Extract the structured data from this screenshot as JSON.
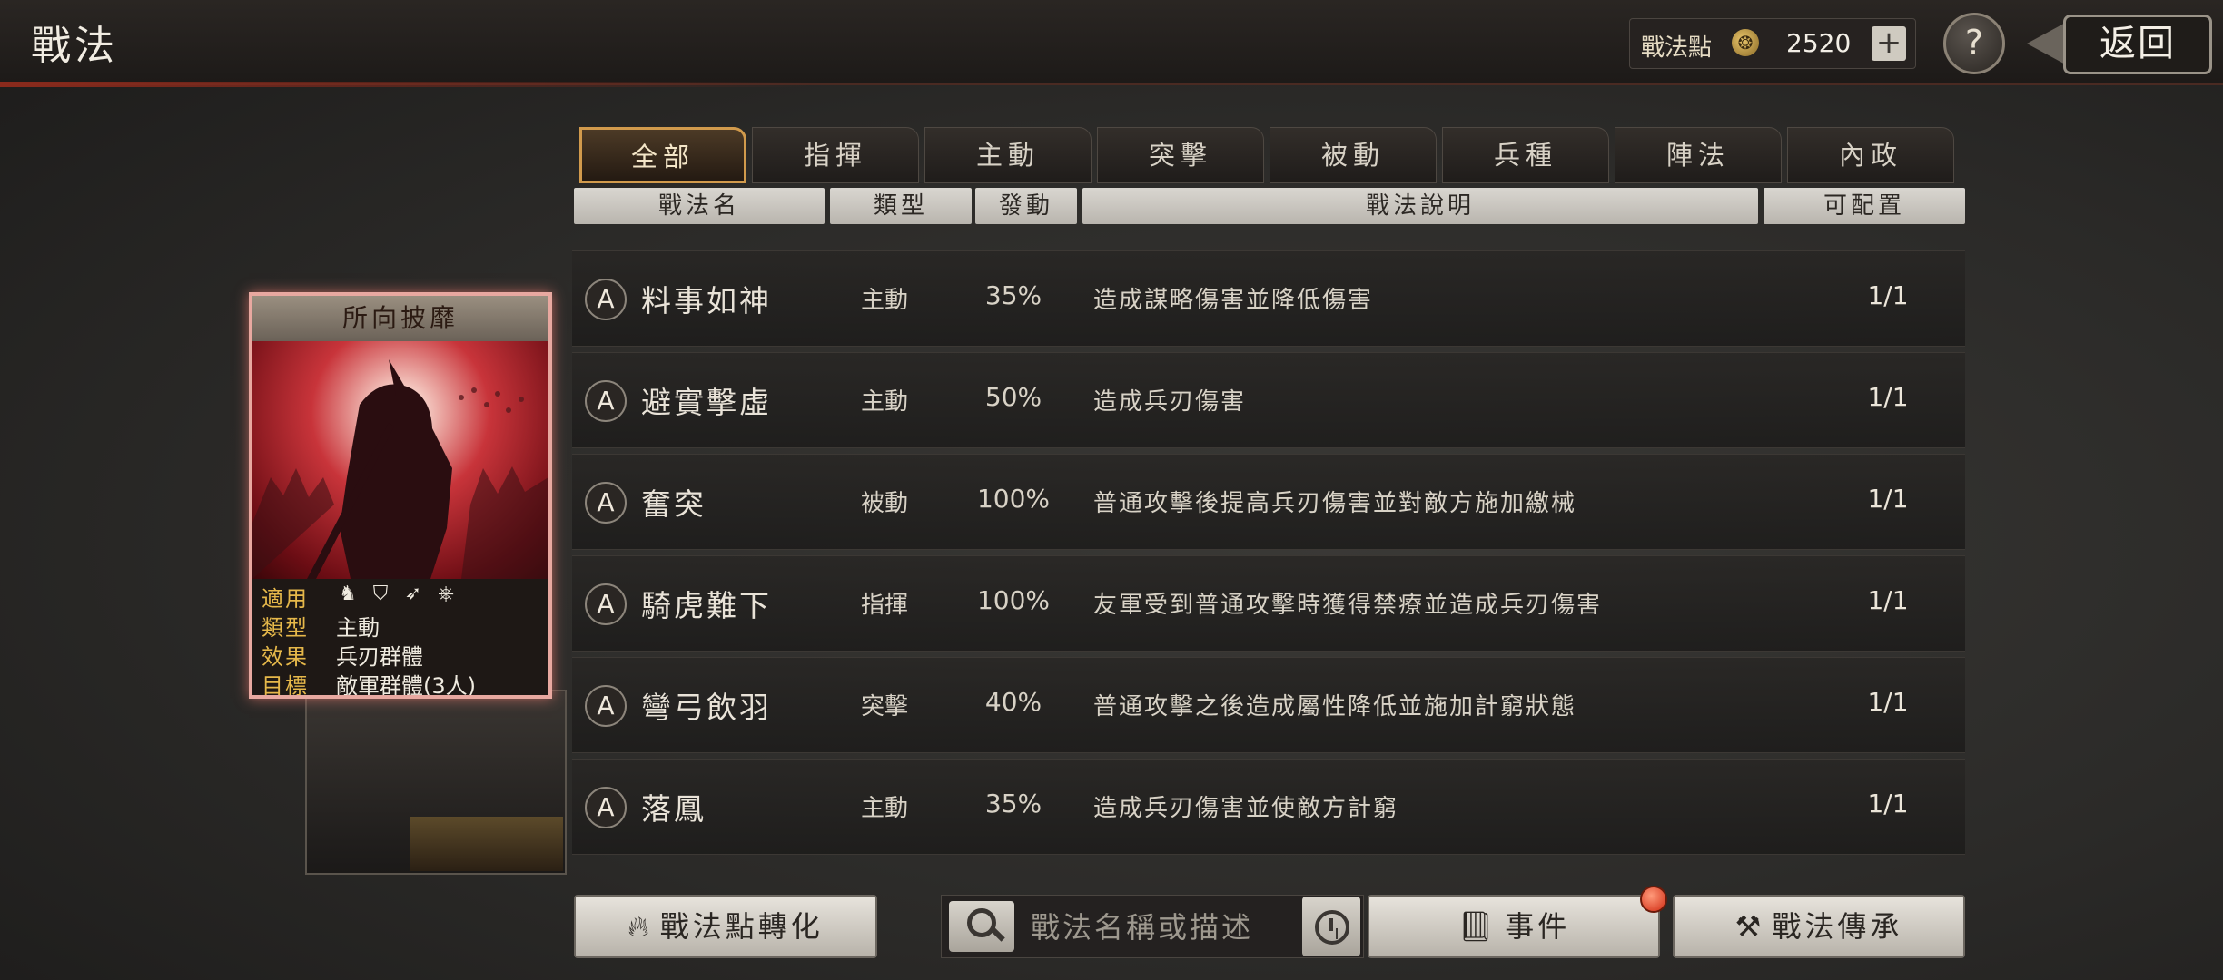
{
  "header": {
    "title": "戰法",
    "points_label": "戰法點",
    "points_value": "2520",
    "plus_label": "+",
    "help_label": "?",
    "back_label": "返回"
  },
  "tabs": [
    "全部",
    "指揮",
    "主動",
    "突擊",
    "被動",
    "兵種",
    "陣法",
    "內政"
  ],
  "active_tab": "全部",
  "columns": {
    "name": "戰法名",
    "type": "類型",
    "rate": "發動",
    "desc": "戰法說明",
    "cfg": "可配置"
  },
  "rows": [
    {
      "grade": "A",
      "name": "料事如神",
      "type": "主動",
      "rate": "35%",
      "desc": "造成謀略傷害並降低傷害",
      "cfg": "1/1"
    },
    {
      "grade": "A",
      "name": "避實擊虛",
      "type": "主動",
      "rate": "50%",
      "desc": "造成兵刃傷害",
      "cfg": "1/1"
    },
    {
      "grade": "A",
      "name": "奮突",
      "type": "被動",
      "rate": "100%",
      "desc": "普通攻擊後提高兵刃傷害並對敵方施加繳械",
      "cfg": "1/1"
    },
    {
      "grade": "A",
      "name": "騎虎難下",
      "type": "指揮",
      "rate": "100%",
      "desc": "友軍受到普通攻擊時獲得禁療並造成兵刃傷害",
      "cfg": "1/1"
    },
    {
      "grade": "A",
      "name": "彎弓飲羽",
      "type": "突擊",
      "rate": "40%",
      "desc": "普通攻擊之後造成屬性降低並施加計窮狀態",
      "cfg": "1/1"
    },
    {
      "grade": "A",
      "name": "落鳳",
      "type": "主動",
      "rate": "35%",
      "desc": "造成兵刃傷害並使敵方計窮",
      "cfg": "1/1"
    }
  ],
  "card": {
    "title": "所向披靡",
    "keys": {
      "apply": "適用",
      "type": "類型",
      "effect": "效果",
      "target": "目標"
    },
    "type": "主動",
    "effect": "兵刃群體",
    "target": "敵軍群體(3人)",
    "apply_icons": [
      "cavalry-icon",
      "shield-icon",
      "archer-icon",
      "chariot-wheel-icon"
    ]
  },
  "bottom": {
    "convert_label": "戰法點轉化",
    "search_placeholder": "戰法名稱或描述",
    "event_label": "事件",
    "inherit_label": "戰法傳承"
  },
  "colors": {
    "accent": "#d19a4c",
    "card_glow": "#e8a8a0",
    "info_key": "#e6b84a",
    "notify": "#d02a12"
  }
}
